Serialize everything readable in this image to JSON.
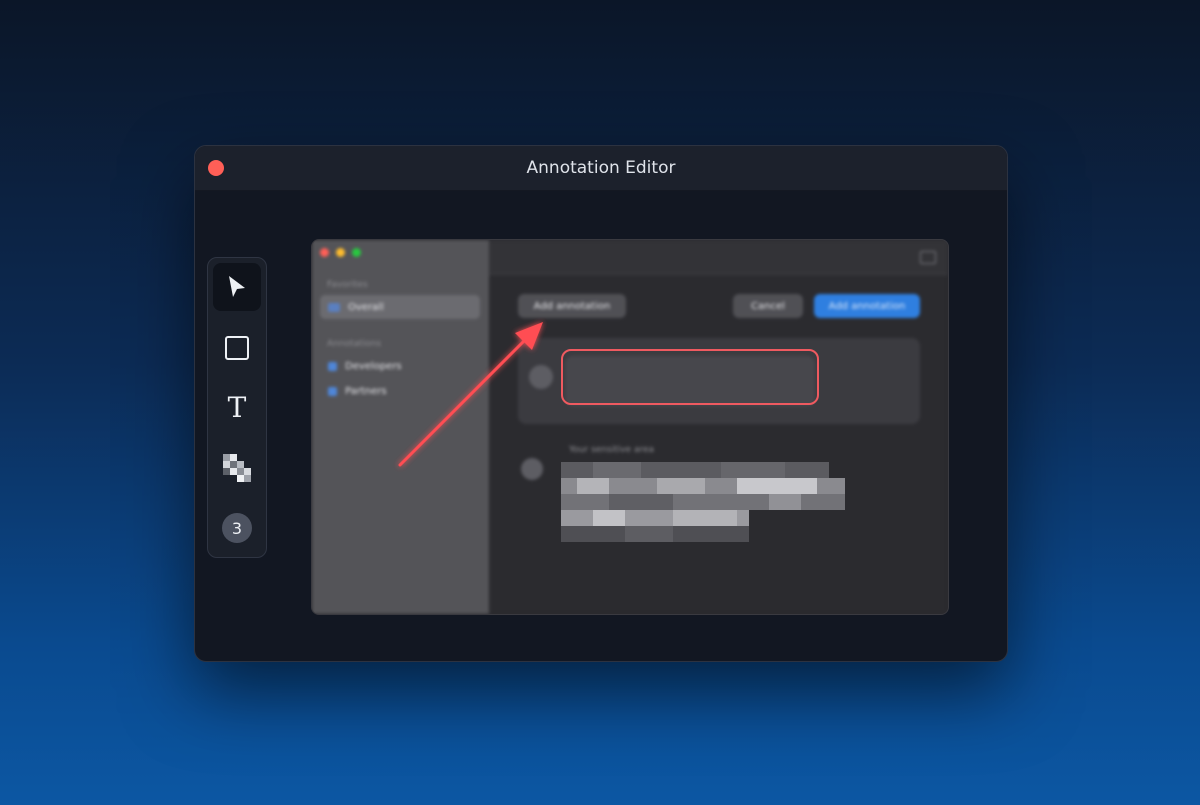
{
  "window": {
    "title": "Annotation Editor"
  },
  "toolbar": {
    "tools": [
      {
        "name": "select",
        "icon": "cursor-icon",
        "active": true
      },
      {
        "name": "rectangle",
        "icon": "rectangle-icon",
        "active": false
      },
      {
        "name": "text",
        "icon": "text-icon",
        "label": "T",
        "active": false
      },
      {
        "name": "pixelate",
        "icon": "pixelate-icon",
        "active": false
      },
      {
        "name": "counter",
        "icon": "counter-icon",
        "label": "3",
        "active": false
      }
    ]
  },
  "screenshot": {
    "sidebar": {
      "section1_heading": "Favorites",
      "section1_items": [
        "Overall"
      ],
      "section2_heading": "Annotations",
      "section2_items": [
        "Developers",
        "Partners"
      ]
    },
    "buttons": {
      "add_left": "Add annotation",
      "cancel": "Cancel",
      "add_primary": "Add annotation"
    },
    "sensitive_label": "Your sensitive area"
  },
  "annotations": {
    "arrow_color": "#ff4d52",
    "rect_color": "#ef5a60"
  },
  "colors": {
    "accent": "#2f7fe0",
    "close": "#ff5f57"
  }
}
